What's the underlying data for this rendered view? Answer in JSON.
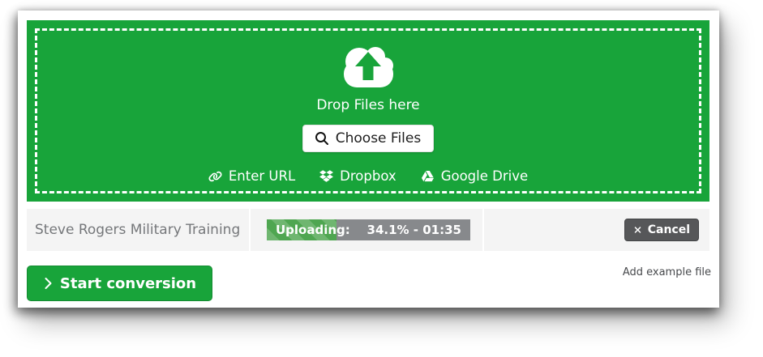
{
  "dropzone": {
    "drop_label": "Drop Files here",
    "choose_files_label": "Choose Files",
    "links": [
      {
        "label": "Enter URL",
        "icon": "link-icon"
      },
      {
        "label": "Dropbox",
        "icon": "dropbox-icon"
      },
      {
        "label": "Google Drive",
        "icon": "google-drive-icon"
      }
    ]
  },
  "upload_row": {
    "filename": "Steve Rogers Military Training",
    "status_label": "Uploading:",
    "progress_value": "34.1% - 01:35",
    "progress_percent": 34.1,
    "cancel_label": "Cancel"
  },
  "actions": {
    "start_label": "Start conversion",
    "add_example_label": "Add example file"
  },
  "colors": {
    "green": "#18a43a",
    "progress_track": "#87898c",
    "progress_fill": "#4fa651",
    "cancel_bg": "#565759"
  }
}
